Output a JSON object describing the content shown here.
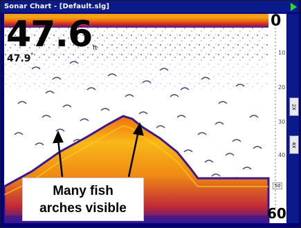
{
  "window": {
    "title": "Sonar Chart - [Default.slg]"
  },
  "display": {
    "depth_reading": "47.6",
    "depth_unit": "ft",
    "secondary_reading": "47.9",
    "secondary_unit": "°"
  },
  "depth_scale": {
    "top": "0",
    "bottom": "60",
    "ticks": [
      "10",
      "20",
      "30",
      "40",
      "50"
    ],
    "marker": "50"
  },
  "zoom_buttons": [
    {
      "label": "2X"
    },
    {
      "label": "4X"
    }
  ],
  "annotation": {
    "line1": "Many fish",
    "line2": "arches visible"
  },
  "colors": {
    "title_bar": "#0a1a8a",
    "sonar_bottom_core": "#f8c21a",
    "sonar_bottom_mid": "#f06a10",
    "sonar_bottom_edge": "#3a1890",
    "surface_clutter": "#e23a12"
  }
}
